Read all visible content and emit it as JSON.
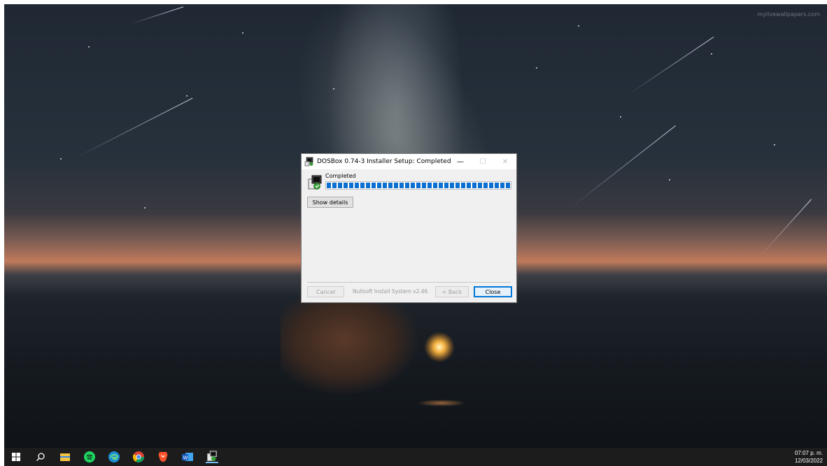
{
  "wallpaper": {
    "watermark": "mylivewallpapers.com"
  },
  "window": {
    "title": "DOSBox 0.74-3 Installer Setup: Completed",
    "status": "Completed",
    "progress_percent": 100,
    "show_details_label": "Show details",
    "cancel_label": "Cancel",
    "brand": "Nullsoft Install System v2.46",
    "back_label": "< Back",
    "close_label": "Close",
    "minimize_glyph": "—",
    "maximize_glyph": "☐",
    "close_glyph": "✕"
  },
  "taskbar": {
    "icons": [
      "windows-start-icon",
      "search-icon",
      "file-explorer-icon",
      "spotify-icon",
      "edge-icon",
      "chrome-icon",
      "brave-icon",
      "word-icon",
      "dosbox-installer-icon"
    ],
    "time": "07:07 p. m.",
    "date": "12/03/2022"
  },
  "colors": {
    "accent": "#0078d7",
    "progress": "#0a6fd0",
    "taskbar": "#1c1c1c"
  }
}
